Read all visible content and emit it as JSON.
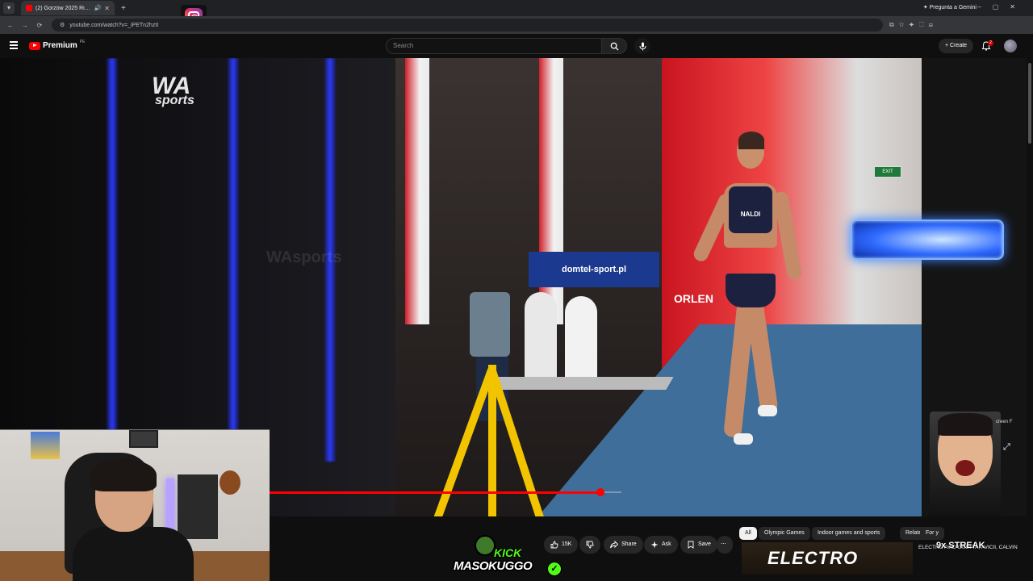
{
  "browser": {
    "tab_title": "(2) Gorzów 2025 Rising Sta",
    "url": "youtube.com/watch?v=_iPETn2hztI",
    "gemini_label": "Pregunta a Gemini"
  },
  "youtube": {
    "logo_text": "Premium",
    "region": "PE",
    "search_placeholder": "Search",
    "create_label": "Create",
    "notif_count": "2"
  },
  "video": {
    "watermark_logo": "WA",
    "watermark_sub": "sports",
    "watermark_text": "WAsports",
    "banner_text": "domtel-sport.pl",
    "sponsor_text": "ORLEN",
    "bib_name": "NALDI",
    "exit_sign": "EXIT",
    "progress_fraction": 0.94,
    "fullscreen_hint": "creen",
    "fullscreen_key": "F"
  },
  "actions": {
    "like_count": "15K",
    "share_label": "Share",
    "ask_label": "Ask",
    "save_label": "Save"
  },
  "chips": [
    {
      "label": "All",
      "active": true
    },
    {
      "label": "Olympic Games"
    },
    {
      "label": "Indoor games and sports"
    },
    {
      "label": "Related"
    },
    {
      "label": "For y"
    }
  ],
  "recommended": {
    "thumb_text": "ELECTRO",
    "title_text": "ELECTRO                    AVID GUETTA, AVICII, CALVIN",
    "streak": "9x STREAK"
  },
  "overlay": {
    "kick_label": "KICK",
    "kick_user": "MASOKUGGO"
  },
  "colors": {
    "yt_red": "#ff0000",
    "kick_green": "#53fc18",
    "background": "#0f0f0f"
  }
}
